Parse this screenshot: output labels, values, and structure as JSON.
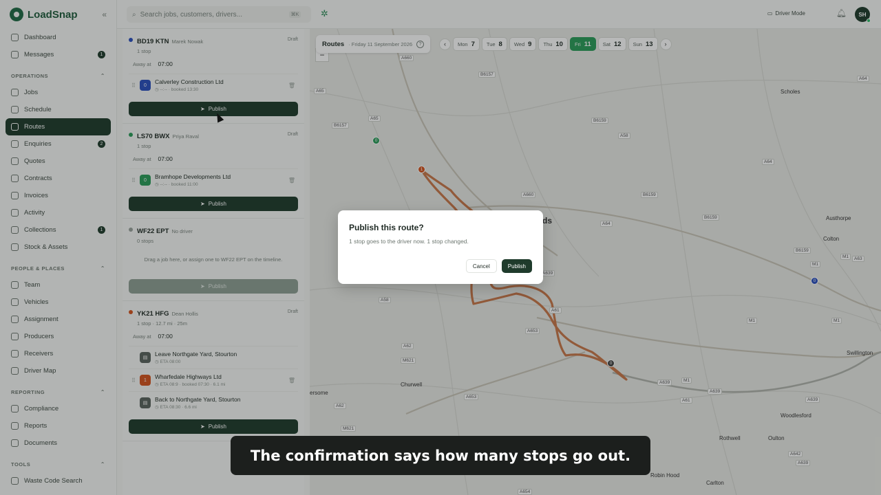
{
  "app": {
    "name": "LoadSnap"
  },
  "sidebar": {
    "top": [
      {
        "label": "Dashboard",
        "badge": ""
      },
      {
        "label": "Messages",
        "badge": "1"
      }
    ],
    "sections": [
      {
        "label": "OPERATIONS",
        "items": [
          {
            "label": "Jobs",
            "badge": ""
          },
          {
            "label": "Schedule",
            "badge": ""
          },
          {
            "label": "Routes",
            "badge": "",
            "active": true
          },
          {
            "label": "Enquiries",
            "badge": "2"
          },
          {
            "label": "Quotes",
            "badge": ""
          },
          {
            "label": "Contracts",
            "badge": ""
          },
          {
            "label": "Invoices",
            "badge": ""
          },
          {
            "label": "Activity",
            "badge": ""
          },
          {
            "label": "Collections",
            "badge": "1"
          },
          {
            "label": "Stock & Assets",
            "badge": ""
          }
        ]
      },
      {
        "label": "PEOPLE & PLACES",
        "items": [
          {
            "label": "Team",
            "badge": ""
          },
          {
            "label": "Vehicles",
            "badge": ""
          },
          {
            "label": "Assignment",
            "badge": ""
          },
          {
            "label": "Producers",
            "badge": ""
          },
          {
            "label": "Receivers",
            "badge": ""
          },
          {
            "label": "Driver Map",
            "badge": ""
          }
        ]
      },
      {
        "label": "REPORTING",
        "items": [
          {
            "label": "Compliance",
            "badge": ""
          },
          {
            "label": "Reports",
            "badge": ""
          },
          {
            "label": "Documents",
            "badge": ""
          }
        ]
      },
      {
        "label": "TOOLS",
        "items": [
          {
            "label": "Waste Code Search",
            "badge": ""
          }
        ]
      }
    ]
  },
  "topbar": {
    "search_placeholder": "Search jobs, customers, drivers...",
    "shortcut": "⌘K",
    "driver_mode": "Driver Mode",
    "avatar_initials": "SH"
  },
  "routes_header": {
    "title": "Routes",
    "date": "· Friday 11 September 2026",
    "days": [
      {
        "name": "Mon",
        "num": "7"
      },
      {
        "name": "Tue",
        "num": "8"
      },
      {
        "name": "Wed",
        "num": "9"
      },
      {
        "name": "Thu",
        "num": "10"
      },
      {
        "name": "Fri",
        "num": "11",
        "active": true
      },
      {
        "name": "Sat",
        "num": "12"
      },
      {
        "name": "Sun",
        "num": "13"
      }
    ]
  },
  "routes": [
    {
      "plate": "BD19 KTN",
      "driver": "Marek Nowak",
      "summary": "1 stop",
      "status": "Draft",
      "color": "#2a4fbf",
      "away_label": "Away at",
      "away_time": "07:00",
      "stops": [
        {
          "num": "0",
          "color": "#2a4fbf",
          "name": "Calverley Construction Ltd",
          "meta": "◷ --:-- · booked 13:30",
          "removable": true
        }
      ],
      "publish_label": "Publish",
      "publish_enabled": true
    },
    {
      "plate": "LS70 BWX",
      "driver": "Priya Raval",
      "summary": "1 stop",
      "status": "Draft",
      "color": "#2a9d5a",
      "away_label": "Away at",
      "away_time": "07:00",
      "stops": [
        {
          "num": "0",
          "color": "#2a9d5a",
          "name": "Bramhope Developments Ltd",
          "meta": "◷ --:-- · booked 11:00",
          "removable": true
        }
      ],
      "publish_label": "Publish",
      "publish_enabled": true
    },
    {
      "plate": "WF22 EPT",
      "driver": "No driver",
      "summary": "0 stops",
      "status": "",
      "color": "#9aa39d",
      "empty_message": "Drag a job here, or assign one to WF22 EPT on the timeline.",
      "publish_label": "Publish",
      "publish_enabled": false
    },
    {
      "plate": "YK21 HFG",
      "driver": "Dean Hollis",
      "summary": "1 stop · 12.7 mi · 25m",
      "status": "Draft",
      "color": "#d4541f",
      "away_label": "Away at",
      "away_time": "07:00",
      "stops": [
        {
          "num": "▤",
          "color": "#5a645e",
          "name": "Leave Northgate Yard, Stourton",
          "meta": "◷ ETA 08:00",
          "removable": false
        },
        {
          "num": "1",
          "color": "#d4541f",
          "name": "Wharfedale Highways Ltd",
          "meta": "◷ ETA 08:9 · booked 07:30 · 6.1 mi",
          "removable": true
        },
        {
          "num": "▤",
          "color": "#5a645e",
          "name": "Back to Northgate Yard, Stourton",
          "meta": "◷ ETA 08:30 · 6.6 mi",
          "removable": false
        }
      ],
      "publish_label": "Publish",
      "publish_enabled": true
    }
  ],
  "map": {
    "road_labels": [
      "A660",
      "B6157",
      "A65",
      "B6157",
      "A65",
      "B6159",
      "A58",
      "A64",
      "A64",
      "A660",
      "B6159",
      "A64",
      "B6159",
      "B6159",
      "A58",
      "A639",
      "A61",
      "A653",
      "A62",
      "M621",
      "A653",
      "A62",
      "M621",
      "A639",
      "M1",
      "A61",
      "A639",
      "A639",
      "M1",
      "M1",
      "A63",
      "M1",
      "M1",
      "A642",
      "A639",
      "A654"
    ],
    "places": [
      "Scholes",
      "Austhorpe",
      "Colton",
      "Swillington",
      "Churwell",
      "ersome",
      "Woodlesford",
      "Rothwell",
      "Oulton",
      "Carlton",
      "Robin Hood",
      "ds"
    ],
    "markers": [
      "0",
      "1",
      "0",
      "0"
    ]
  },
  "modal": {
    "title": "Publish this route?",
    "body": "1 stop goes to the driver now. 1 stop changed.",
    "cancel_label": "Cancel",
    "publish_label": "Publish"
  },
  "caption": "The confirmation says how many stops go out."
}
